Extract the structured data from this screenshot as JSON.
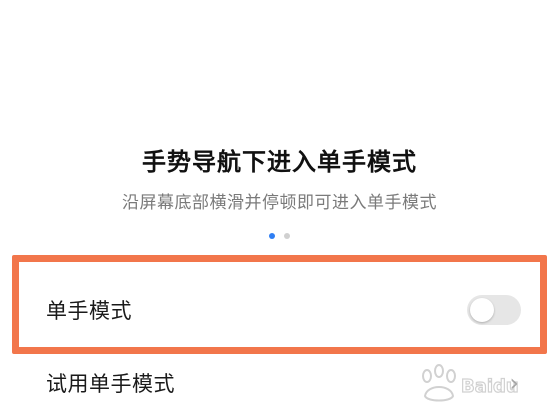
{
  "title": "手势导航下进入单手模式",
  "subtitle": "沿屏幕底部横滑并停顿即可进入单手模式",
  "pager": {
    "total": 2,
    "active_index": 0
  },
  "settings": [
    {
      "label": "单手模式",
      "control": "toggle",
      "value": "off"
    },
    {
      "label": "试用单手模式",
      "control": "chevron"
    }
  ],
  "colors": {
    "highlight_border": "#f2764b",
    "pager_active": "#2f7ef3",
    "pager_inactive": "#d0d0d0",
    "toggle_off_track": "#e6e6e6"
  },
  "icons": {
    "chevron": "chevron-right-icon",
    "watermark": "baidu-logo-watermark"
  }
}
